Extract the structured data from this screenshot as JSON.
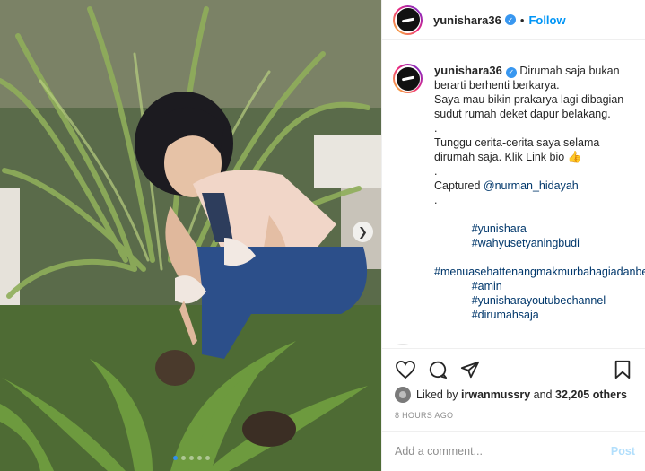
{
  "post": {
    "username": "yunishara36",
    "verified_icon": "verified-badge-icon",
    "separator": "•",
    "follow_label": "Follow",
    "caption_lines": [
      "Dirumah saja bukan berarti berhenti berkarya.",
      "Saya mau bikin prakarya lagi dibagian sudut rumah deket dapur belakang.",
      ".",
      "Tunggu cerita-cerita saya selama dirumah saja. Klik Link bio 👍",
      ".",
      "Captured ",
      ".",
      "#yunishara #wahyusetyaningbudi #menuasehattenangmakmurbahagia danberuntung #amin #yunisharayoutubechannel #dirumahsaja"
    ],
    "caption_text_1": "Dirumah saja bukan berarti berhenti berkarya.",
    "caption_text_2": "Saya mau bikin prakarya lagi dibagian sudut rumah deket dapur belakang.",
    "caption_dot": ".",
    "caption_text_3": "Tunggu cerita-cerita saya selama dirumah saja. Klik Link bio 👍",
    "captured_label": "Captured ",
    "captured_mention": "@nurman_hidayah",
    "hashtags": [
      "#yunishara",
      "#wahyusetyaningbudi",
      "#menuasehattenangmakmurbahagia",
      "danberuntung",
      "#amin",
      "#yunisharayoutubechannel",
      "#dirumahsaja"
    ],
    "caption_age": "8h",
    "liked_by_prefix": "Liked by ",
    "liked_by_user": "irwanmussry",
    "liked_by_middle": " and ",
    "likes_count": "32,205 others",
    "posted_time": "8 HOURS AGO",
    "comment_placeholder": "Add a comment...",
    "post_label": "Post"
  },
  "carousel": {
    "total_slides": 5,
    "active_slide": 1
  },
  "icons": {
    "like": "heart-icon",
    "comment": "comment-bubble-icon",
    "share": "paper-plane-icon",
    "save": "bookmark-icon",
    "next": "chevron-right-icon"
  },
  "colors": {
    "link": "#00376b",
    "follow": "#0095f6",
    "verified": "#3897f0",
    "muted": "#8e8e8e",
    "post_disabled": "#b2dffc"
  }
}
